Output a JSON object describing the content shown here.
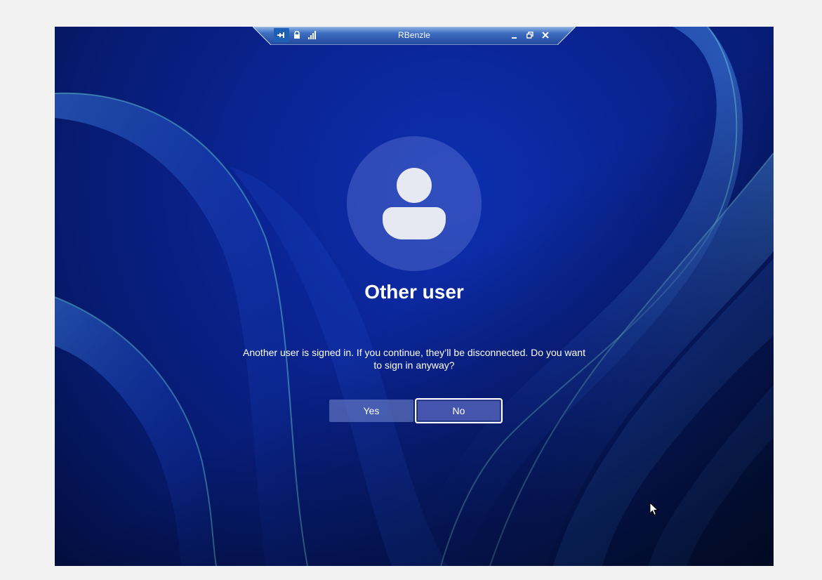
{
  "rdp_bar": {
    "title": "RBenzle",
    "icons": [
      "pin-icon",
      "lock-icon",
      "signal-icon",
      "minimize-icon",
      "restore-icon",
      "close-icon"
    ]
  },
  "login": {
    "avatar_icon": "user-silhouette-icon",
    "user_name": "Other user",
    "message": "Another user is signed in. If you continue, they’ll be disconnected. Do you want to sign in anyway?",
    "yes_label": "Yes",
    "no_label": "No"
  },
  "colors": {
    "background": "#0a2494",
    "button_focus_border": "#ffffff"
  }
}
